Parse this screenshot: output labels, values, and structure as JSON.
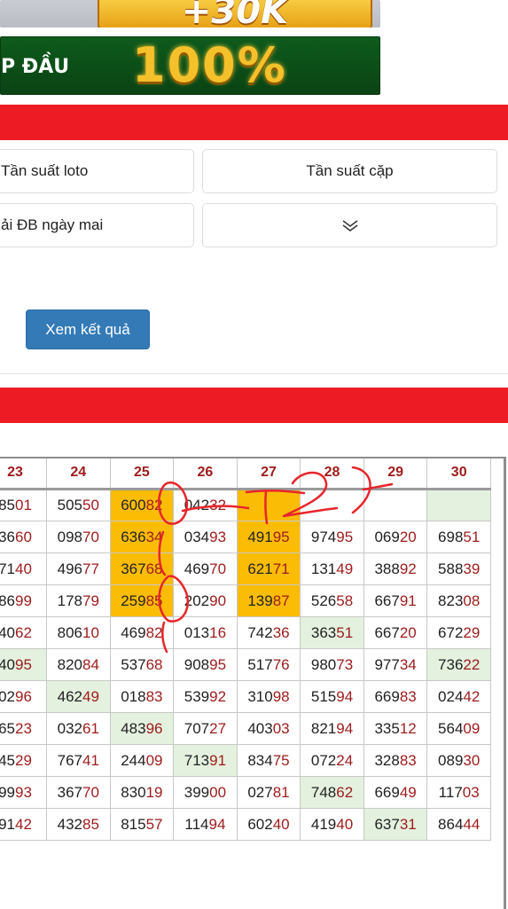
{
  "banners": {
    "top_bonus": "+30K",
    "slogan": "P ĐẦU",
    "percent": "100%"
  },
  "options": {
    "loto": "Tần suất loto",
    "cap": "Tần suất cặp",
    "db": "ải ĐB ngày mai"
  },
  "submit_label": "Xem kết quả",
  "table": {
    "headers": [
      "23",
      "24",
      "25",
      "26",
      "27",
      "28",
      "29",
      "30"
    ],
    "rows": [
      [
        [
          "85",
          "01",
          ""
        ],
        [
          "505",
          "50",
          ""
        ],
        [
          "600",
          "82",
          "y"
        ],
        [
          "042",
          "32",
          ""
        ],
        [
          "",
          "",
          "y"
        ],
        [
          "",
          "",
          ""
        ],
        [
          "",
          "",
          ""
        ],
        [
          "",
          "",
          "g"
        ]
      ],
      [
        [
          "36",
          "60",
          ""
        ],
        [
          "098",
          "70",
          ""
        ],
        [
          "636",
          "34",
          "y"
        ],
        [
          "034",
          "93",
          ""
        ],
        [
          "491",
          "95",
          "y"
        ],
        [
          "974",
          "95",
          ""
        ],
        [
          "069",
          "20",
          ""
        ],
        [
          "698",
          "51",
          ""
        ]
      ],
      [
        [
          "71",
          "40",
          ""
        ],
        [
          "496",
          "77",
          ""
        ],
        [
          "367",
          "68",
          "y"
        ],
        [
          "469",
          "70",
          ""
        ],
        [
          "621",
          "71",
          "y"
        ],
        [
          "131",
          "49",
          ""
        ],
        [
          "388",
          "92",
          ""
        ],
        [
          "588",
          "39",
          ""
        ]
      ],
      [
        [
          "86",
          "99",
          ""
        ],
        [
          "178",
          "79",
          ""
        ],
        [
          "259",
          "85",
          "y"
        ],
        [
          "202",
          "90",
          ""
        ],
        [
          "139",
          "87",
          "y"
        ],
        [
          "526",
          "58",
          ""
        ],
        [
          "667",
          "91",
          ""
        ],
        [
          "823",
          "08",
          ""
        ]
      ],
      [
        [
          "40",
          "62",
          ""
        ],
        [
          "806",
          "10",
          ""
        ],
        [
          "469",
          "82",
          ""
        ],
        [
          "013",
          "16",
          ""
        ],
        [
          "742",
          "36",
          ""
        ],
        [
          "363",
          "51",
          "g"
        ],
        [
          "667",
          "20",
          ""
        ],
        [
          "672",
          "29",
          ""
        ]
      ],
      [
        [
          "40",
          "95",
          "g"
        ],
        [
          "820",
          "84",
          ""
        ],
        [
          "537",
          "68",
          ""
        ],
        [
          "908",
          "95",
          ""
        ],
        [
          "517",
          "76",
          ""
        ],
        [
          "980",
          "73",
          ""
        ],
        [
          "977",
          "34",
          ""
        ],
        [
          "736",
          "22",
          "g"
        ]
      ],
      [
        [
          "02",
          "96",
          ""
        ],
        [
          "462",
          "49",
          "g"
        ],
        [
          "018",
          "83",
          ""
        ],
        [
          "539",
          "92",
          ""
        ],
        [
          "310",
          "98",
          ""
        ],
        [
          "515",
          "94",
          ""
        ],
        [
          "669",
          "83",
          ""
        ],
        [
          "024",
          "42",
          ""
        ]
      ],
      [
        [
          "65",
          "23",
          ""
        ],
        [
          "032",
          "61",
          ""
        ],
        [
          "483",
          "96",
          "g"
        ],
        [
          "707",
          "27",
          ""
        ],
        [
          "403",
          "03",
          ""
        ],
        [
          "821",
          "94",
          ""
        ],
        [
          "335",
          "12",
          ""
        ],
        [
          "564",
          "09",
          ""
        ]
      ],
      [
        [
          "45",
          "29",
          ""
        ],
        [
          "767",
          "41",
          ""
        ],
        [
          "244",
          "09",
          ""
        ],
        [
          "713",
          "91",
          "g"
        ],
        [
          "834",
          "75",
          ""
        ],
        [
          "072",
          "24",
          ""
        ],
        [
          "328",
          "83",
          ""
        ],
        [
          "089",
          "30",
          ""
        ]
      ],
      [
        [
          "99",
          "93",
          ""
        ],
        [
          "367",
          "70",
          ""
        ],
        [
          "830",
          "19",
          ""
        ],
        [
          "399",
          "00",
          ""
        ],
        [
          "027",
          "81",
          ""
        ],
        [
          "748",
          "62",
          "g"
        ],
        [
          "669",
          "49",
          ""
        ],
        [
          "117",
          "03",
          ""
        ]
      ],
      [
        [
          "91",
          "42",
          ""
        ],
        [
          "432",
          "85",
          ""
        ],
        [
          "815",
          "57",
          ""
        ],
        [
          "114",
          "94",
          ""
        ],
        [
          "602",
          "40",
          ""
        ],
        [
          "419",
          "40",
          ""
        ],
        [
          "637",
          "31",
          "g"
        ],
        [
          "864",
          "44",
          ""
        ]
      ]
    ]
  },
  "annotation": "T2)"
}
